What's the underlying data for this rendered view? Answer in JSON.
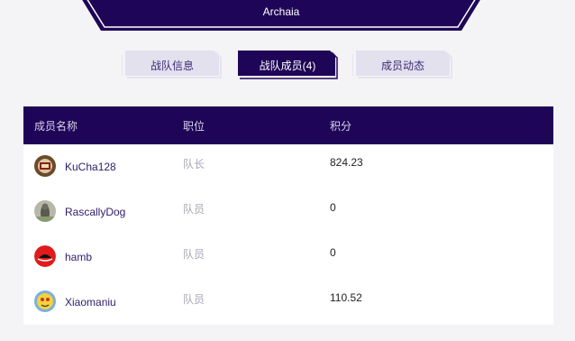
{
  "banner": {
    "title": "Archaia"
  },
  "tabs": [
    {
      "label": "战队信息",
      "active": false
    },
    {
      "label": "战队成员(4)",
      "active": true
    },
    {
      "label": "成员动态",
      "active": false
    }
  ],
  "table": {
    "headers": {
      "name": "成员名称",
      "role": "职位",
      "score": "积分"
    },
    "rows": [
      {
        "name": "KuCha128",
        "role": "队长",
        "score": "824.23",
        "avatar": "avatar-kucha"
      },
      {
        "name": "RascallyDog",
        "role": "队员",
        "score": "0",
        "avatar": "avatar-dog"
      },
      {
        "name": "hamb",
        "role": "队员",
        "score": "0",
        "avatar": "avatar-redhat"
      },
      {
        "name": "Xiaomaniu",
        "role": "队员",
        "score": "110.52",
        "avatar": "avatar-cartoon"
      }
    ]
  },
  "colors": {
    "accent": "#1f0557",
    "link": "#2e1d6b",
    "muted": "#a8a8b4"
  }
}
